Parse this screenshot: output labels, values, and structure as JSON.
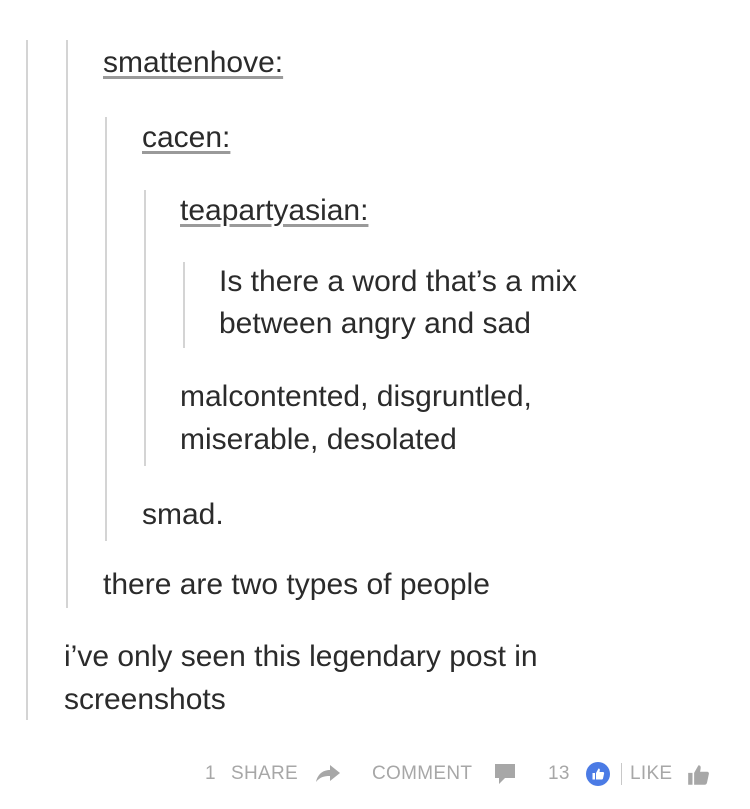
{
  "post": {
    "reblog_chain": [
      {
        "username": "smattenhove:"
      },
      {
        "username": "cacen:"
      },
      {
        "username": "teapartyasian:"
      }
    ],
    "original_text_line1": "Is there a word that’s a mix",
    "original_text_line2": "between angry and sad",
    "teapartyasian_reply_line1": "malcontented, disgruntled,",
    "teapartyasian_reply_line2": "miserable, desolated",
    "cacen_reply": "smad.",
    "smattenhove_reply": "there are two types of people",
    "final_comment_line1": "i’ve only seen this legendary post in",
    "final_comment_line2": "screenshots"
  },
  "footer": {
    "share_count": "1",
    "share_label": "SHARE",
    "comment_label": "COMMENT",
    "like_count": "13",
    "like_label": "LIKE",
    "accent_color": "#4b7be5",
    "icons": [
      "share-arrow-icon",
      "comment-bubble-icon",
      "thumbs-up-badge-icon",
      "thumbs-up-icon"
    ]
  }
}
